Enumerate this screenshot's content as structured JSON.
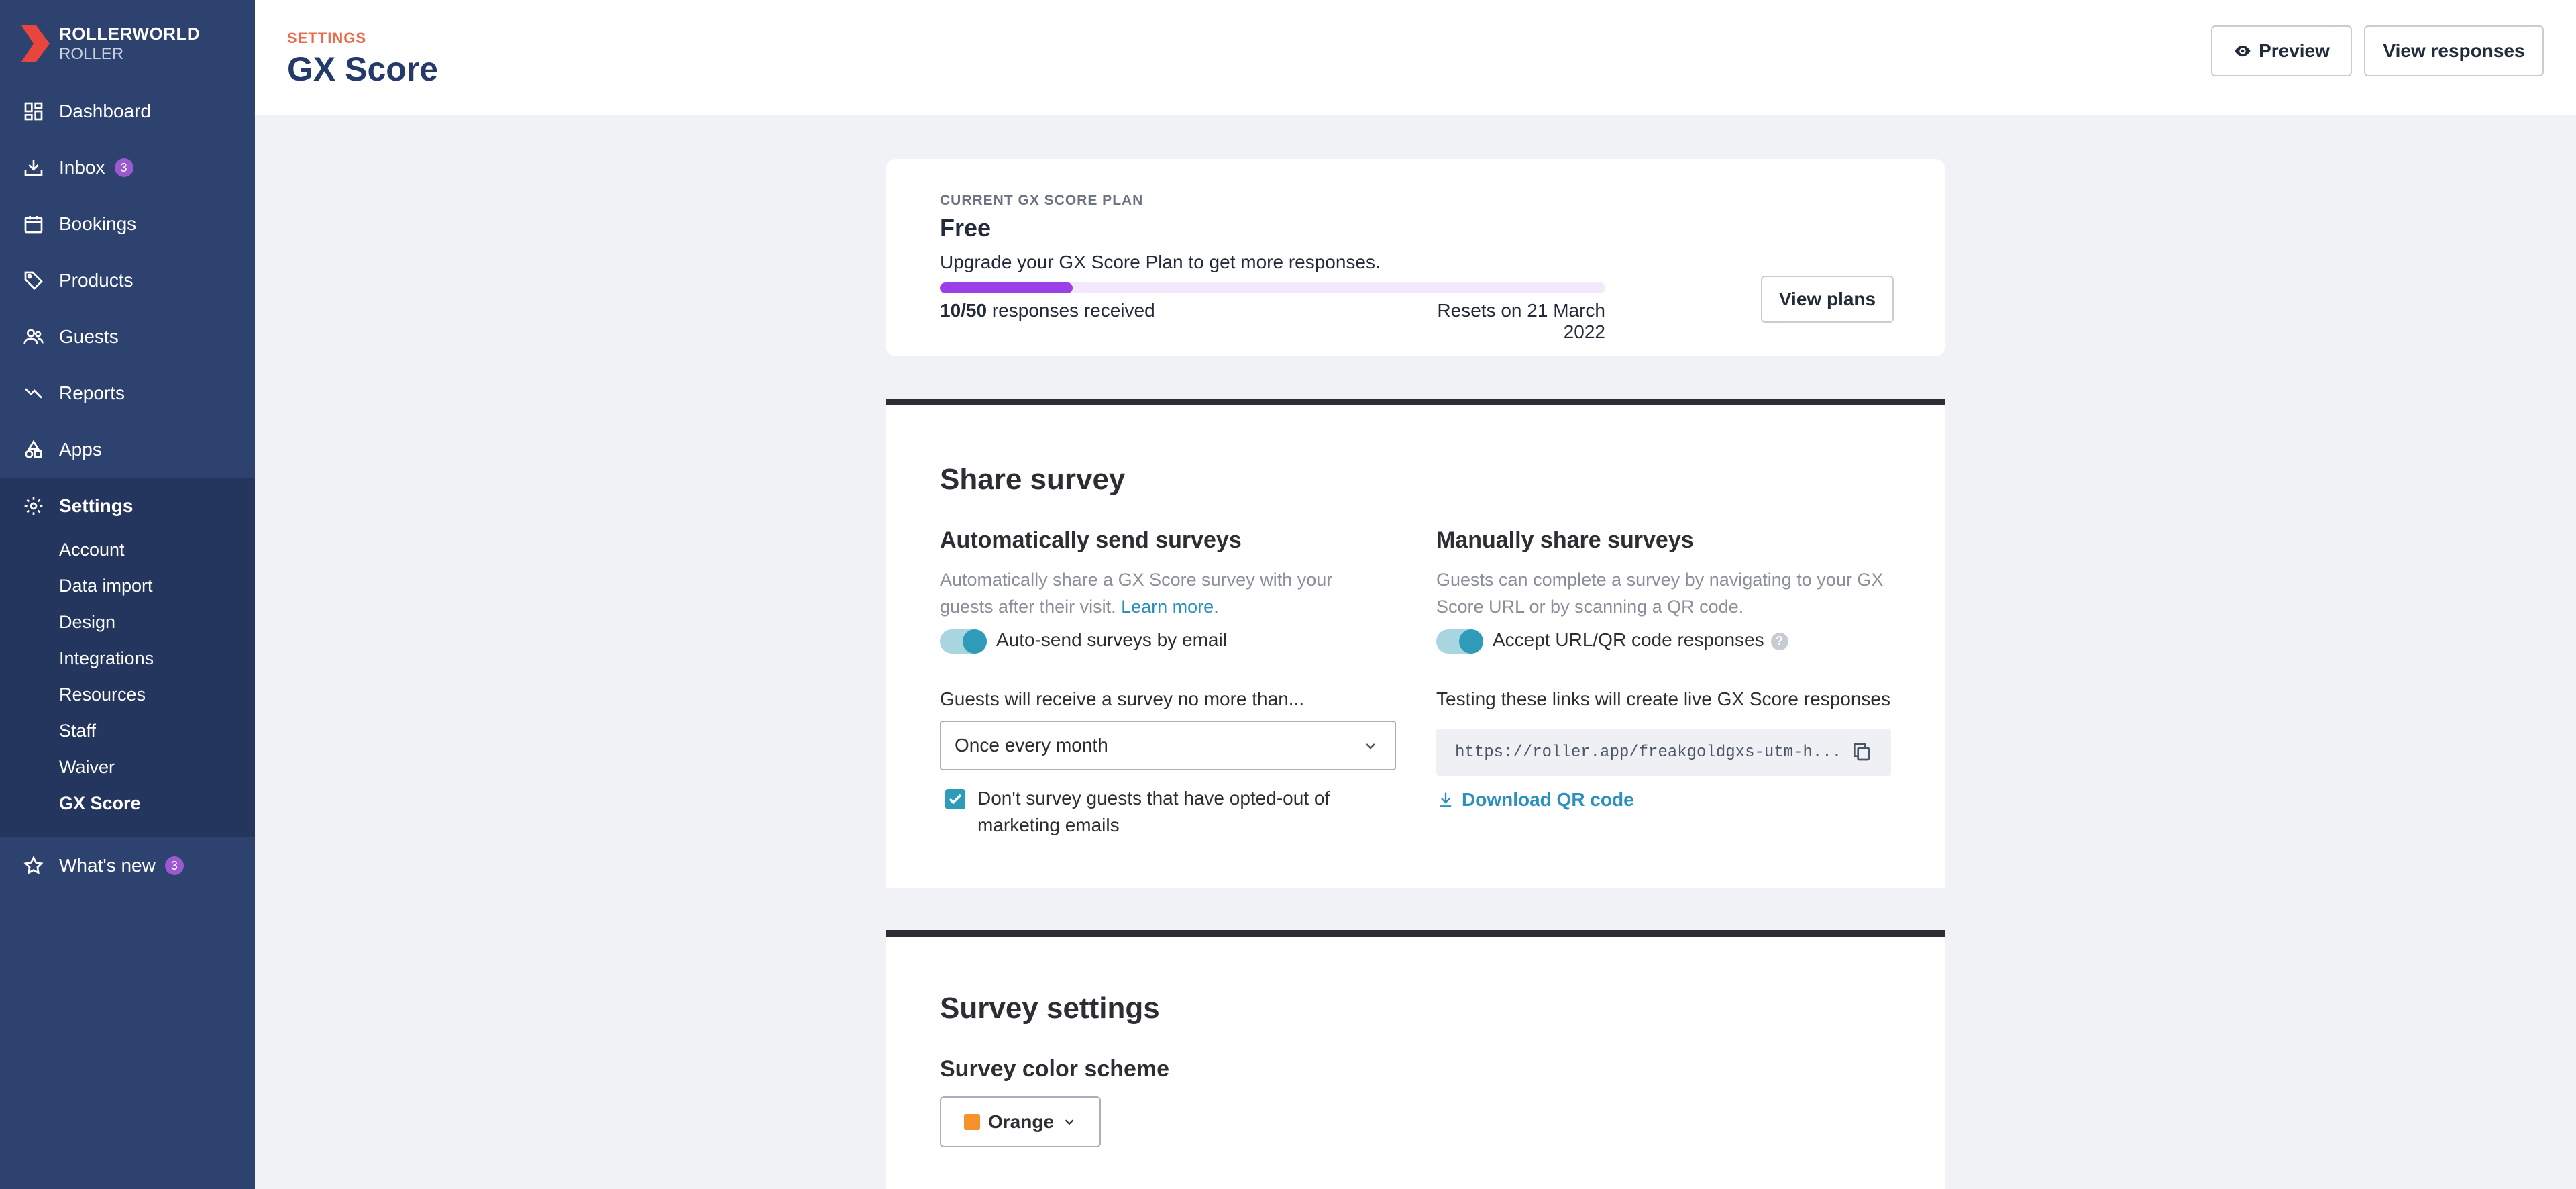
{
  "brand": {
    "name": "ROLLERWORLD",
    "sub": "ROLLER",
    "accent_color": "#e8453c"
  },
  "sidebar": {
    "items": [
      {
        "label": "Dashboard",
        "icon": "dashboard-icon"
      },
      {
        "label": "Inbox",
        "icon": "inbox-icon",
        "badge": "3"
      },
      {
        "label": "Bookings",
        "icon": "calendar-icon"
      },
      {
        "label": "Products",
        "icon": "tag-icon"
      },
      {
        "label": "Guests",
        "icon": "guests-icon"
      },
      {
        "label": "Reports",
        "icon": "chart-line-icon"
      },
      {
        "label": "Apps",
        "icon": "apps-icon"
      },
      {
        "label": "Settings",
        "icon": "gear-icon"
      }
    ],
    "settings_sub": [
      "Account",
      "Data import",
      "Design",
      "Integrations",
      "Resources",
      "Staff",
      "Waiver",
      "GX Score"
    ],
    "whats_new": {
      "label": "What's new",
      "icon": "star-icon",
      "badge": "3"
    }
  },
  "header": {
    "crumb": "SETTINGS",
    "title": "GX Score",
    "preview_label": "Preview",
    "view_responses_label": "View responses"
  },
  "plan": {
    "label": "CURRENT GX SCORE PLAN",
    "name": "Free",
    "description": "Upgrade your GX Score Plan to get more responses.",
    "count": "10/50",
    "count_suffix": "responses received",
    "progress_fraction": 0.2,
    "reset_text": "Resets on 21 March 2022",
    "view_plans_label": "View plans"
  },
  "share": {
    "title": "Share survey",
    "auto": {
      "title": "Automatically send surveys",
      "desc": "Automatically share a GX Score survey with your guests after their visit.",
      "learn_more": "Learn more.",
      "toggle_label": "Auto-send surveys by email",
      "frequency_label": "Guests will receive a survey no more than...",
      "frequency_value": "Once every month",
      "checkbox_label": "Don't survey guests that have opted-out of marketing emails"
    },
    "manual": {
      "title": "Manually share surveys",
      "desc": "Guests can complete a survey by navigating to your GX Score URL or by scanning a QR code.",
      "toggle_label": "Accept URL/QR code responses",
      "testing_note": "Testing these links will create live GX Score responses",
      "url": "https://roller.app/freakgoldgxs-utm-h...",
      "qr_label": "Download QR code"
    }
  },
  "survey_settings": {
    "title": "Survey settings",
    "color_title": "Survey color scheme",
    "color_value": "Orange",
    "color_hex": "#f7912b"
  }
}
